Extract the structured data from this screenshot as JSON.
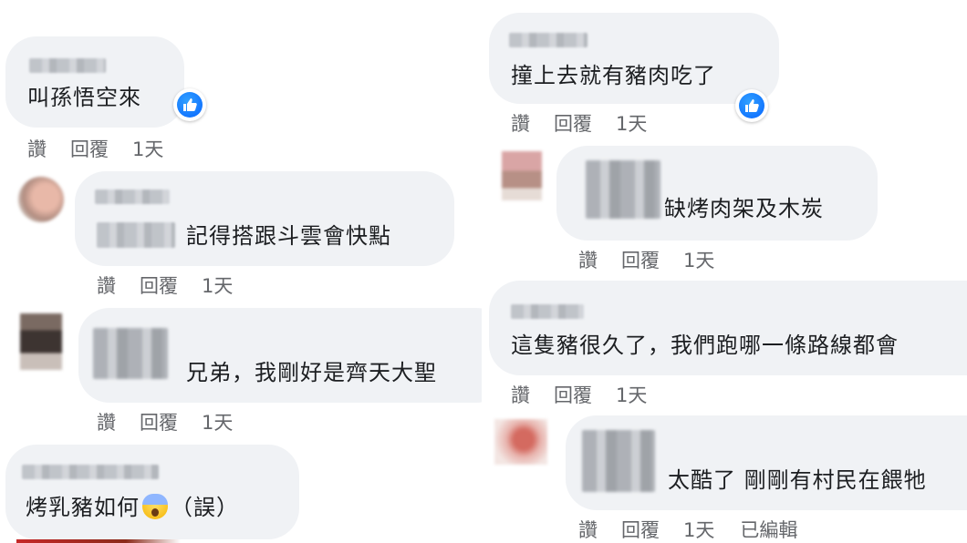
{
  "left_column": {
    "comments": [
      {
        "text": "叫孫悟空來",
        "reaction": "like-icon",
        "actions": {
          "like": "讚",
          "reply": "回覆",
          "time": "1天"
        }
      },
      {
        "text": "記得搭跟斗雲會快點",
        "actions": {
          "like": "讚",
          "reply": "回覆",
          "time": "1天"
        }
      },
      {
        "text": "兄弟，我剛好是齊天大聖",
        "actions": {
          "like": "讚",
          "reply": "回覆",
          "time": "1天"
        }
      },
      {
        "text_before": "烤乳豬如何",
        "text_after": "（誤）",
        "emoji": "screaming-face-icon"
      }
    ]
  },
  "right_column": {
    "comments": [
      {
        "text": "撞上去就有豬肉吃了",
        "reaction": "like-icon",
        "actions": {
          "like": "讚",
          "reply": "回覆",
          "time": "1天"
        }
      },
      {
        "text": "缺烤肉架及木炭",
        "actions": {
          "like": "讚",
          "reply": "回覆",
          "time": "1天"
        }
      },
      {
        "text": "這隻豬很久了，我們跑哪一條路線都會",
        "actions": {
          "like": "讚",
          "reply": "回覆",
          "time": "1天"
        }
      },
      {
        "text": "太酷了 剛剛有村民在餵牠",
        "actions": {
          "like": "讚",
          "reply": "回覆",
          "time": "1天",
          "edited": "已編輯"
        }
      }
    ]
  },
  "colors": {
    "bubble_bg": "#f0f2f5",
    "text": "#1c1e21",
    "meta_text": "#65676b",
    "like_blue": "#0866ff"
  }
}
